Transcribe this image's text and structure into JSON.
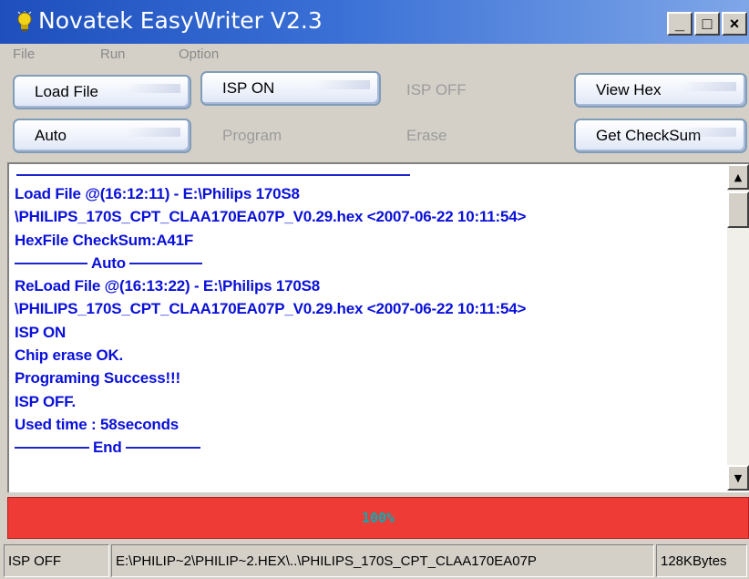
{
  "window": {
    "title": "Novatek EasyWriter V2.3",
    "icon": "lightbulb-icon",
    "controls": {
      "minimize": "_",
      "maximize": "□",
      "close": "×"
    }
  },
  "menu": {
    "file": "File",
    "run": "Run",
    "option": "Option"
  },
  "buttons": {
    "load_file": "Load File",
    "isp_on": "ISP ON",
    "isp_off": "ISP OFF",
    "view_hex": "View Hex",
    "auto": "Auto",
    "program": "Program",
    "erase": "Erase",
    "get_checksum": "Get CheckSum"
  },
  "log": {
    "lines": [
      "Load File @(16:12:11) - E:\\Philips 170S8",
      "\\PHILIPS_170S_CPT_CLAA170EA07P_V0.29.hex <2007-06-22 10:11:54>",
      "HexFile CheckSum:A41F",
      "Auto",
      "ReLoad File @(16:13:22) - E:\\Philips 170S8",
      "\\PHILIPS_170S_CPT_CLAA170EA07P_V0.29.hex <2007-06-22 10:11:54>",
      "ISP ON",
      "Chip erase OK.",
      "Programing Success!!!",
      "ISP OFF.",
      "Used time : 58seconds",
      "End"
    ]
  },
  "scrollbar": {
    "up": "▲",
    "down": "▼"
  },
  "progress": {
    "label": "100%",
    "value": 1.0
  },
  "status": {
    "state": "ISP OFF",
    "path": "E:\\PHILIP~2\\PHILIP~2.HEX\\..\\PHILIPS_170S_CPT_CLAA170EA07P",
    "size": "128KBytes"
  },
  "colors": {
    "log_text": "#0a10d8",
    "progress_fill": "#ee3b35",
    "progress_text": "#00b0b8",
    "titlebar": "#1e4fbd"
  }
}
